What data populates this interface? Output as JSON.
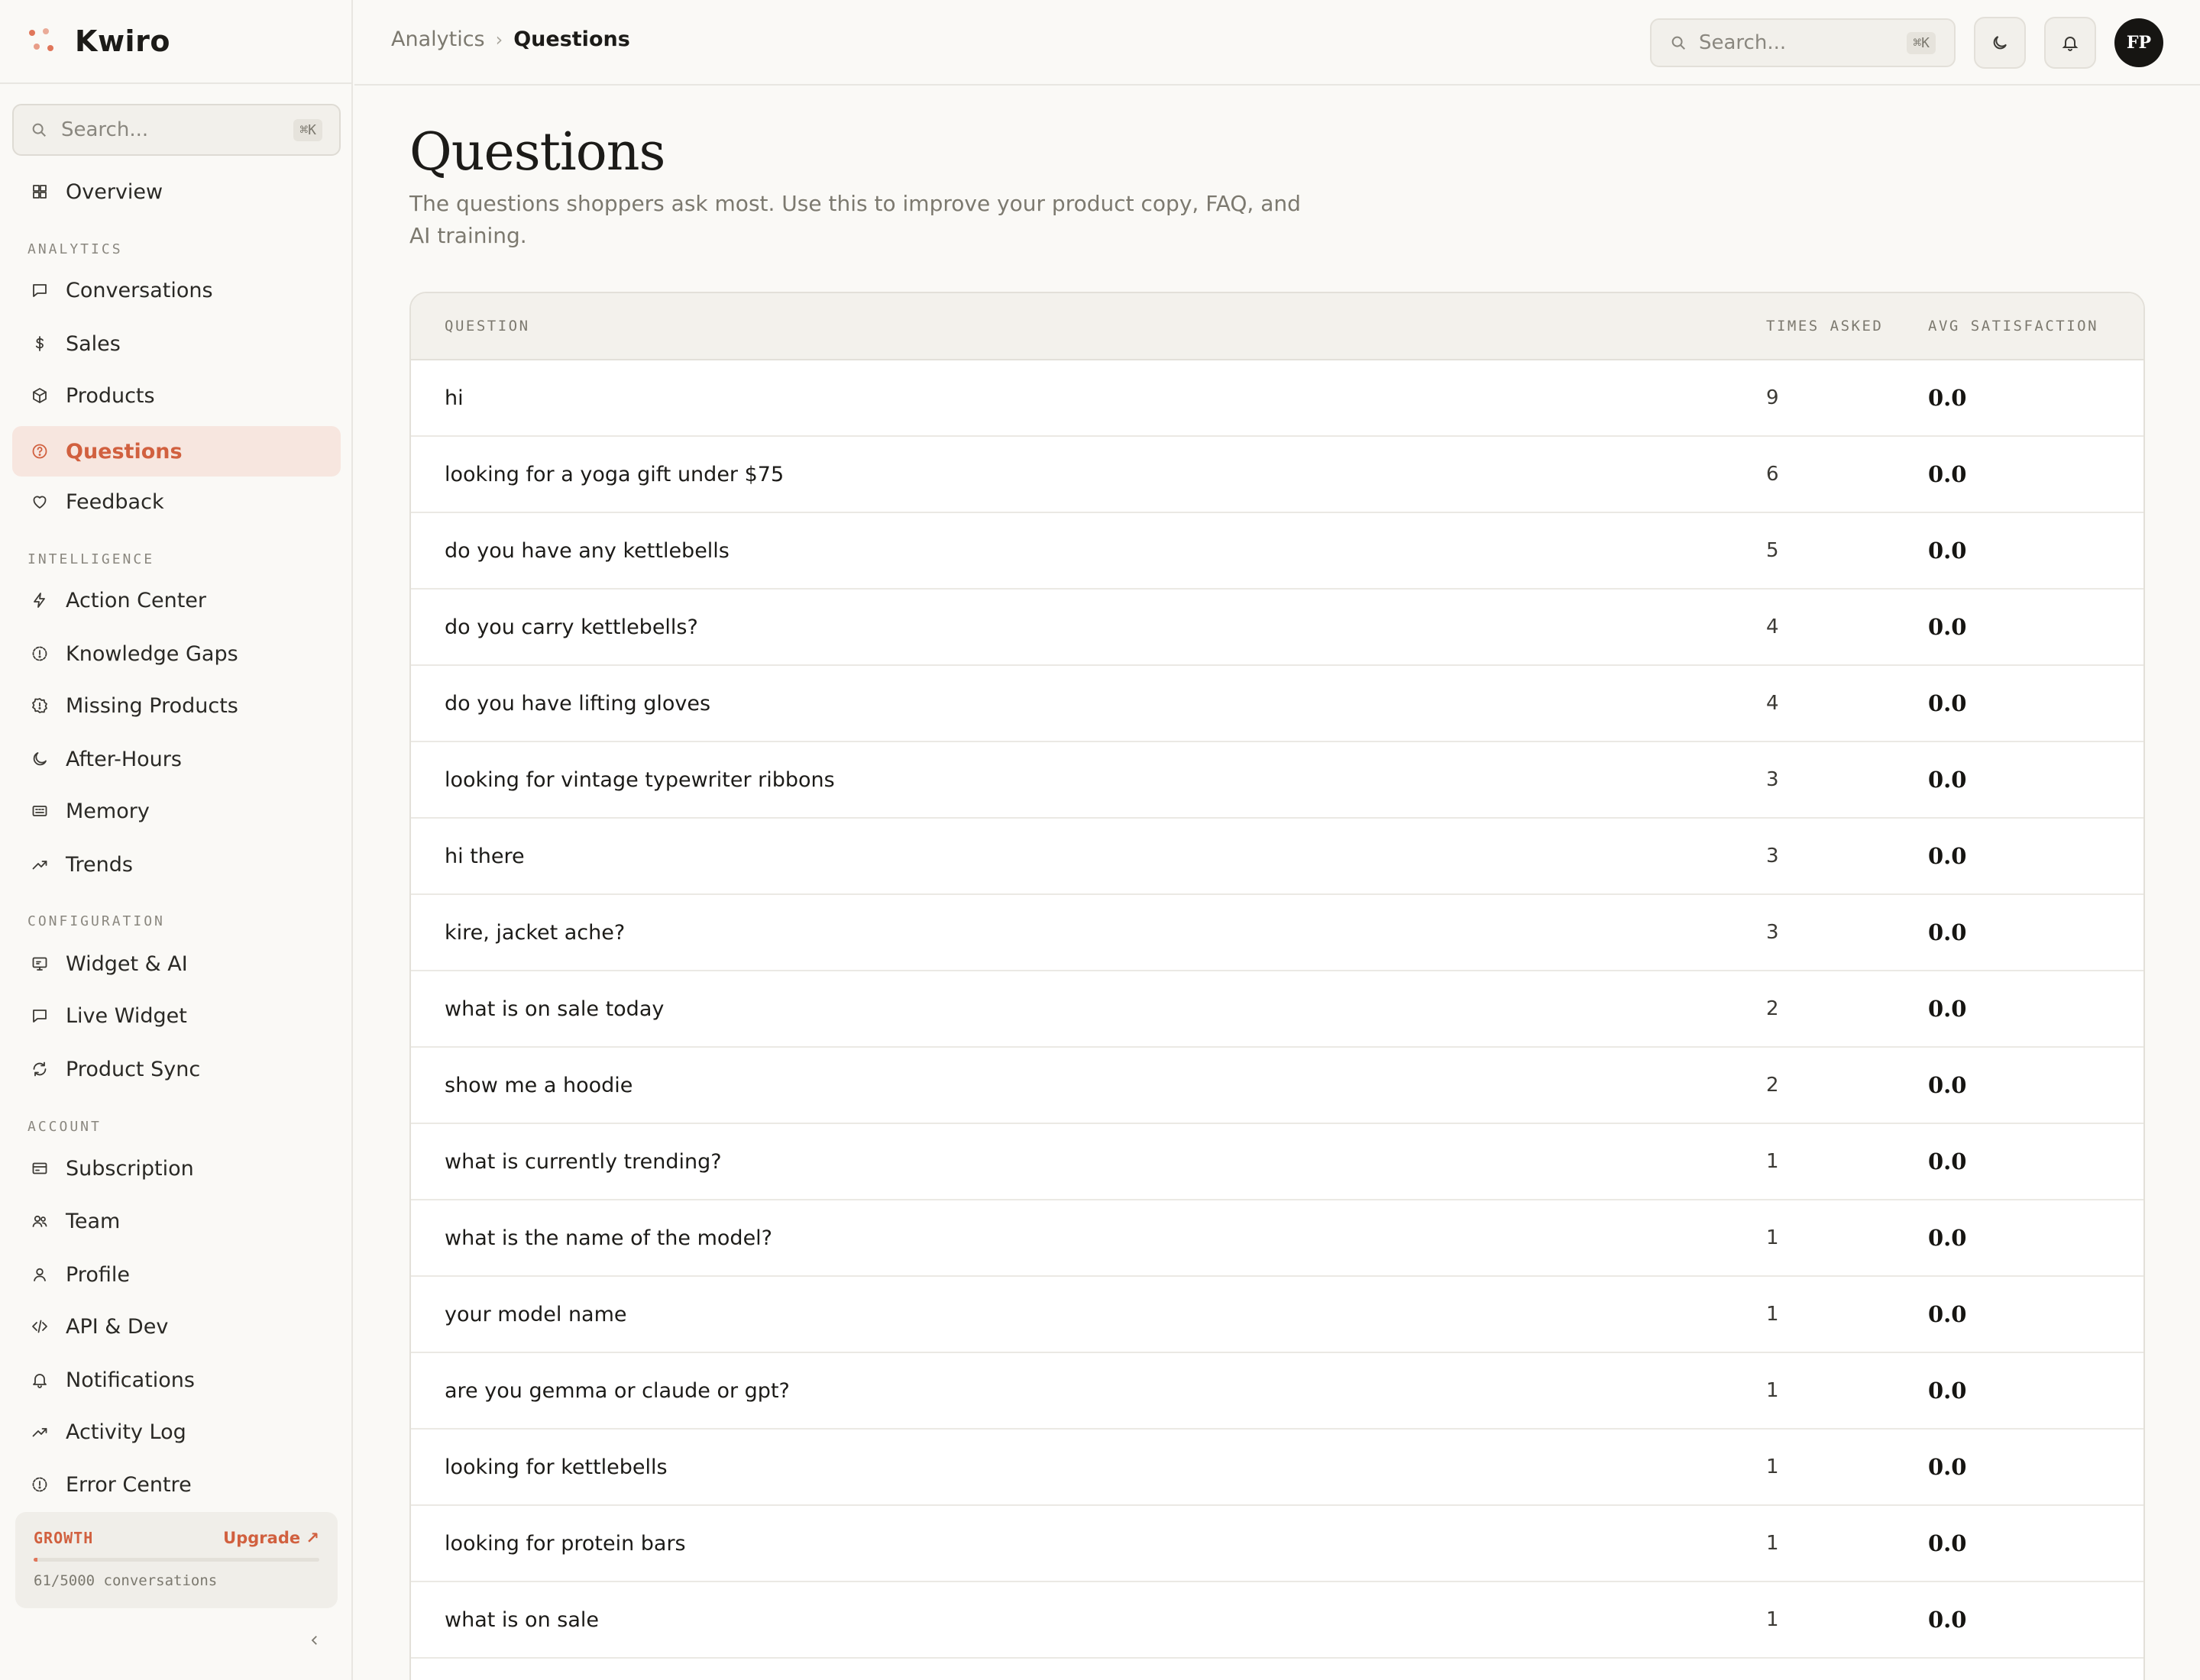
{
  "brand": {
    "name": "Kwiro"
  },
  "sidebar": {
    "search": {
      "placeholder": "Search...",
      "shortcut": "⌘K"
    },
    "overview": {
      "label": "Overview",
      "icon": "grid-icon"
    },
    "sections": [
      {
        "label": "ANALYTICS",
        "items": [
          {
            "label": "Conversations",
            "icon": "chat-icon"
          },
          {
            "label": "Sales",
            "icon": "dollar-icon"
          },
          {
            "label": "Products",
            "icon": "box-icon"
          },
          {
            "label": "Questions",
            "icon": "help-circle-icon",
            "active": true
          },
          {
            "label": "Feedback",
            "icon": "heart-icon"
          }
        ]
      },
      {
        "label": "INTELLIGENCE",
        "items": [
          {
            "label": "Action Center",
            "icon": "bolt-icon"
          },
          {
            "label": "Knowledge Gaps",
            "icon": "alert-circle-icon"
          },
          {
            "label": "Missing Products",
            "icon": "alert-badge-icon"
          },
          {
            "label": "After-Hours",
            "icon": "moon-icon"
          },
          {
            "label": "Memory",
            "icon": "memory-icon"
          },
          {
            "label": "Trends",
            "icon": "trend-icon"
          }
        ]
      },
      {
        "label": "CONFIGURATION",
        "items": [
          {
            "label": "Widget & AI",
            "icon": "monitor-icon"
          },
          {
            "label": "Live Widget",
            "icon": "chat-icon"
          },
          {
            "label": "Product Sync",
            "icon": "refresh-icon"
          }
        ]
      },
      {
        "label": "ACCOUNT",
        "items": [
          {
            "label": "Subscription",
            "icon": "card-icon"
          },
          {
            "label": "Team",
            "icon": "users-icon"
          },
          {
            "label": "Profile",
            "icon": "user-icon"
          },
          {
            "label": "API & Dev",
            "icon": "code-icon"
          },
          {
            "label": "Notifications",
            "icon": "bell-icon"
          },
          {
            "label": "Activity Log",
            "icon": "trend-icon"
          },
          {
            "label": "Error Centre",
            "icon": "alert-circle-icon"
          }
        ]
      }
    ],
    "plan": {
      "name": "GROWTH",
      "upgrade_label": "Upgrade ↗",
      "usage_text": "61/5000 conversations",
      "usage_fraction": 0.0122
    }
  },
  "topbar": {
    "breadcrumb": {
      "parent": "Analytics",
      "separator": "›",
      "current": "Questions"
    },
    "search": {
      "placeholder": "Search...",
      "shortcut": "⌘K"
    },
    "avatar_initials": "FP"
  },
  "page": {
    "title": "Questions",
    "description": "The questions shoppers ask most. Use this to improve your product copy, FAQ, and AI training."
  },
  "table": {
    "headers": {
      "question": "QUESTION",
      "times_asked": "TIMES ASKED",
      "avg_satisfaction": "AVG SATISFACTION"
    },
    "rows": [
      {
        "question": "hi",
        "times_asked": "9",
        "avg_satisfaction": "0.0"
      },
      {
        "question": "looking for a yoga gift under $75",
        "times_asked": "6",
        "avg_satisfaction": "0.0"
      },
      {
        "question": "do you have any kettlebells",
        "times_asked": "5",
        "avg_satisfaction": "0.0"
      },
      {
        "question": "do you carry kettlebells?",
        "times_asked": "4",
        "avg_satisfaction": "0.0"
      },
      {
        "question": "do you have lifting gloves",
        "times_asked": "4",
        "avg_satisfaction": "0.0"
      },
      {
        "question": "looking for vintage typewriter ribbons",
        "times_asked": "3",
        "avg_satisfaction": "0.0"
      },
      {
        "question": "hi there",
        "times_asked": "3",
        "avg_satisfaction": "0.0"
      },
      {
        "question": "kire, jacket ache?",
        "times_asked": "3",
        "avg_satisfaction": "0.0"
      },
      {
        "question": "what is on sale today",
        "times_asked": "2",
        "avg_satisfaction": "0.0"
      },
      {
        "question": "show me a hoodie",
        "times_asked": "2",
        "avg_satisfaction": "0.0"
      },
      {
        "question": "what is currently trending?",
        "times_asked": "1",
        "avg_satisfaction": "0.0"
      },
      {
        "question": "what is the name of the model?",
        "times_asked": "1",
        "avg_satisfaction": "0.0"
      },
      {
        "question": "your model name",
        "times_asked": "1",
        "avg_satisfaction": "0.0"
      },
      {
        "question": "are you gemma or claude or gpt?",
        "times_asked": "1",
        "avg_satisfaction": "0.0"
      },
      {
        "question": "looking for kettlebells",
        "times_asked": "1",
        "avg_satisfaction": "0.0"
      },
      {
        "question": "looking for protein bars",
        "times_asked": "1",
        "avg_satisfaction": "0.0"
      },
      {
        "question": "what is on sale",
        "times_asked": "1",
        "avg_satisfaction": "0.0"
      }
    ]
  },
  "colors": {
    "accent": "#d1603f",
    "accent_bg": "#f7e6df",
    "background": "#faf9f6",
    "border": "#e3e0d9"
  }
}
